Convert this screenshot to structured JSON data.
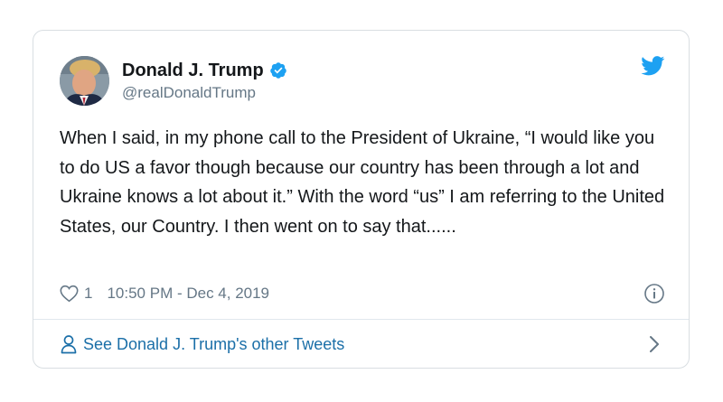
{
  "author": {
    "display_name": "Donald J. Trump",
    "handle": "@realDonaldTrump",
    "verified": true
  },
  "tweet": {
    "text": "When I said, in my phone call to the President of Ukraine, “I would like you to do US a favor though because our country has been through a lot and Ukraine knows a lot about it.” With the word “us” I am referring to the United States, our Country. I then went on to say that......",
    "like_count": "1",
    "timestamp": "10:50 PM - Dec 4, 2019"
  },
  "footer": {
    "label": "See Donald J. Trump's other Tweets"
  },
  "icons": {
    "brand": "twitter-bird-icon",
    "verified": "verified-badge-icon",
    "like": "heart-icon",
    "info": "info-icon",
    "profile": "person-icon",
    "next": "chevron-right-icon"
  },
  "colors": {
    "accent": "#1da1f2",
    "link": "#1b6fa8",
    "text": "#14171a",
    "secondary": "#657786",
    "border": "#d9dee2"
  }
}
